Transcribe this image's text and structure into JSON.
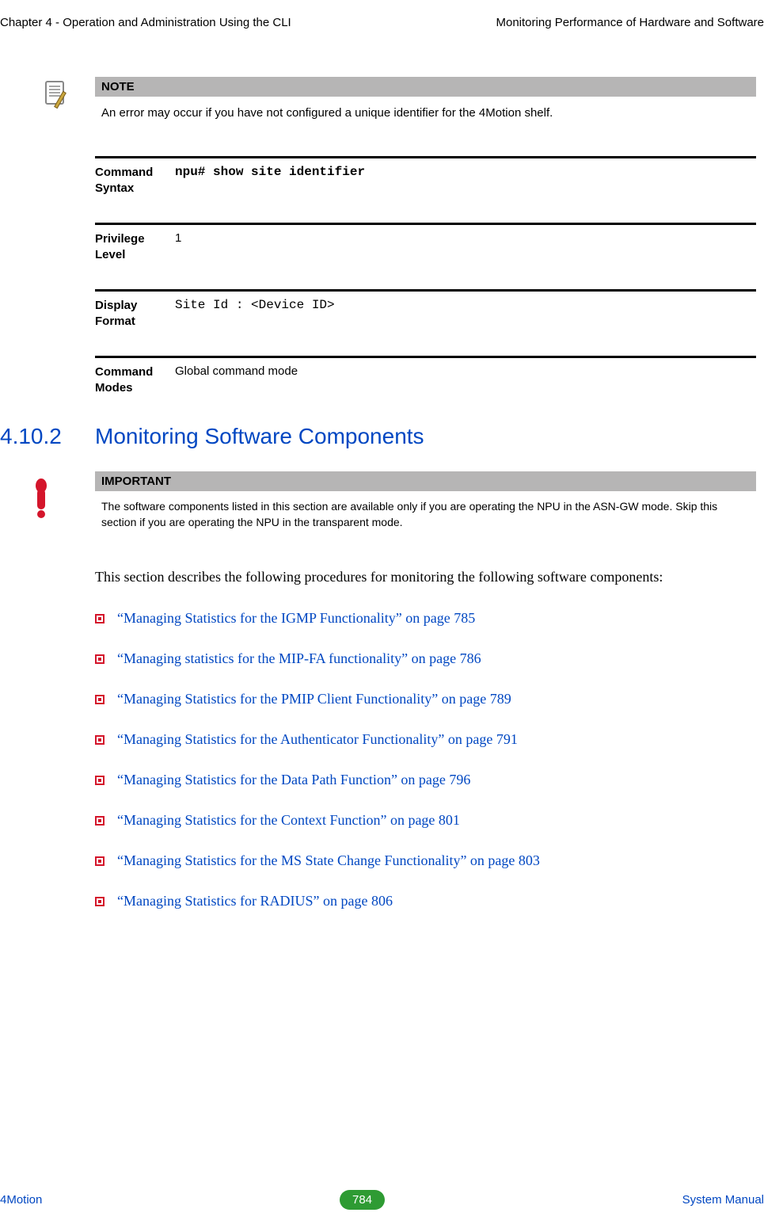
{
  "header": {
    "left": "Chapter 4 - Operation and Administration Using the CLI",
    "right": "Monitoring Performance of Hardware and Software"
  },
  "note": {
    "label": "NOTE",
    "text": "An error may occur if you have not configured a unique identifier for the 4Motion shelf."
  },
  "defs": {
    "command_syntax_label": "Command Syntax",
    "command_syntax_value": "npu# show site identifier",
    "privilege_level_label": "Privilege Level",
    "privilege_level_value": "1",
    "display_format_label": "Display Format",
    "display_format_value": "Site Id  :  <Device ID>",
    "command_modes_label": "Command Modes",
    "command_modes_value": "Global command mode"
  },
  "section": {
    "number": "4.10.2",
    "title": "Monitoring Software Components"
  },
  "important": {
    "label": "IMPORTANT",
    "text": "The software components listed in this section are available only if you are operating the NPU in the ASN-GW mode. Skip this section if you are operating the NPU in the transparent mode."
  },
  "intro": "This section describes the following procedures for monitoring the following software components:",
  "links": [
    "“Managing Statistics for the IGMP Functionality” on page 785",
    "“Managing statistics for the MIP-FA functionality” on page 786",
    "“Managing Statistics for the PMIP Client Functionality” on page 789",
    "“Managing Statistics for the Authenticator Functionality” on page 791",
    "“Managing Statistics for the Data Path Function” on page 796",
    "“Managing Statistics for the Context Function” on page 801",
    "“Managing Statistics for the MS State Change Functionality” on page 803",
    "“Managing Statistics for RADIUS” on page 806"
  ],
  "footer": {
    "left": "4Motion",
    "page": "784",
    "right": "System Manual"
  }
}
